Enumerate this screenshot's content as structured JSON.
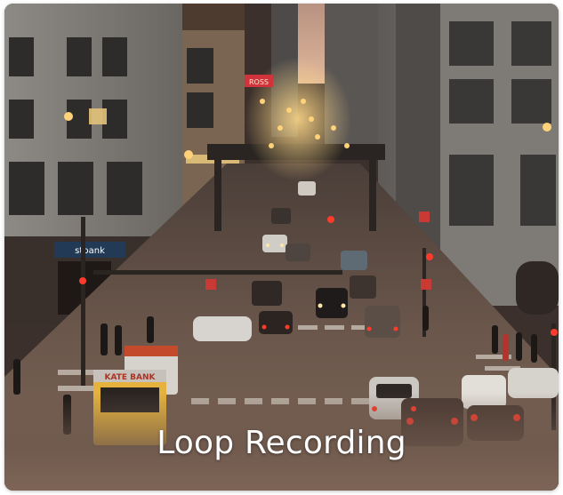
{
  "card": {
    "caption": "Loop Recording",
    "sign_left": "stbank",
    "sign_bus": "KATE BANK",
    "sign_top": "ROSS"
  },
  "colors": {
    "caption_text": "#ffffff",
    "sky": "#c9a08a",
    "road": "#6a564b",
    "headlight": "#ffd27a",
    "taillight": "#ff3b2b"
  }
}
